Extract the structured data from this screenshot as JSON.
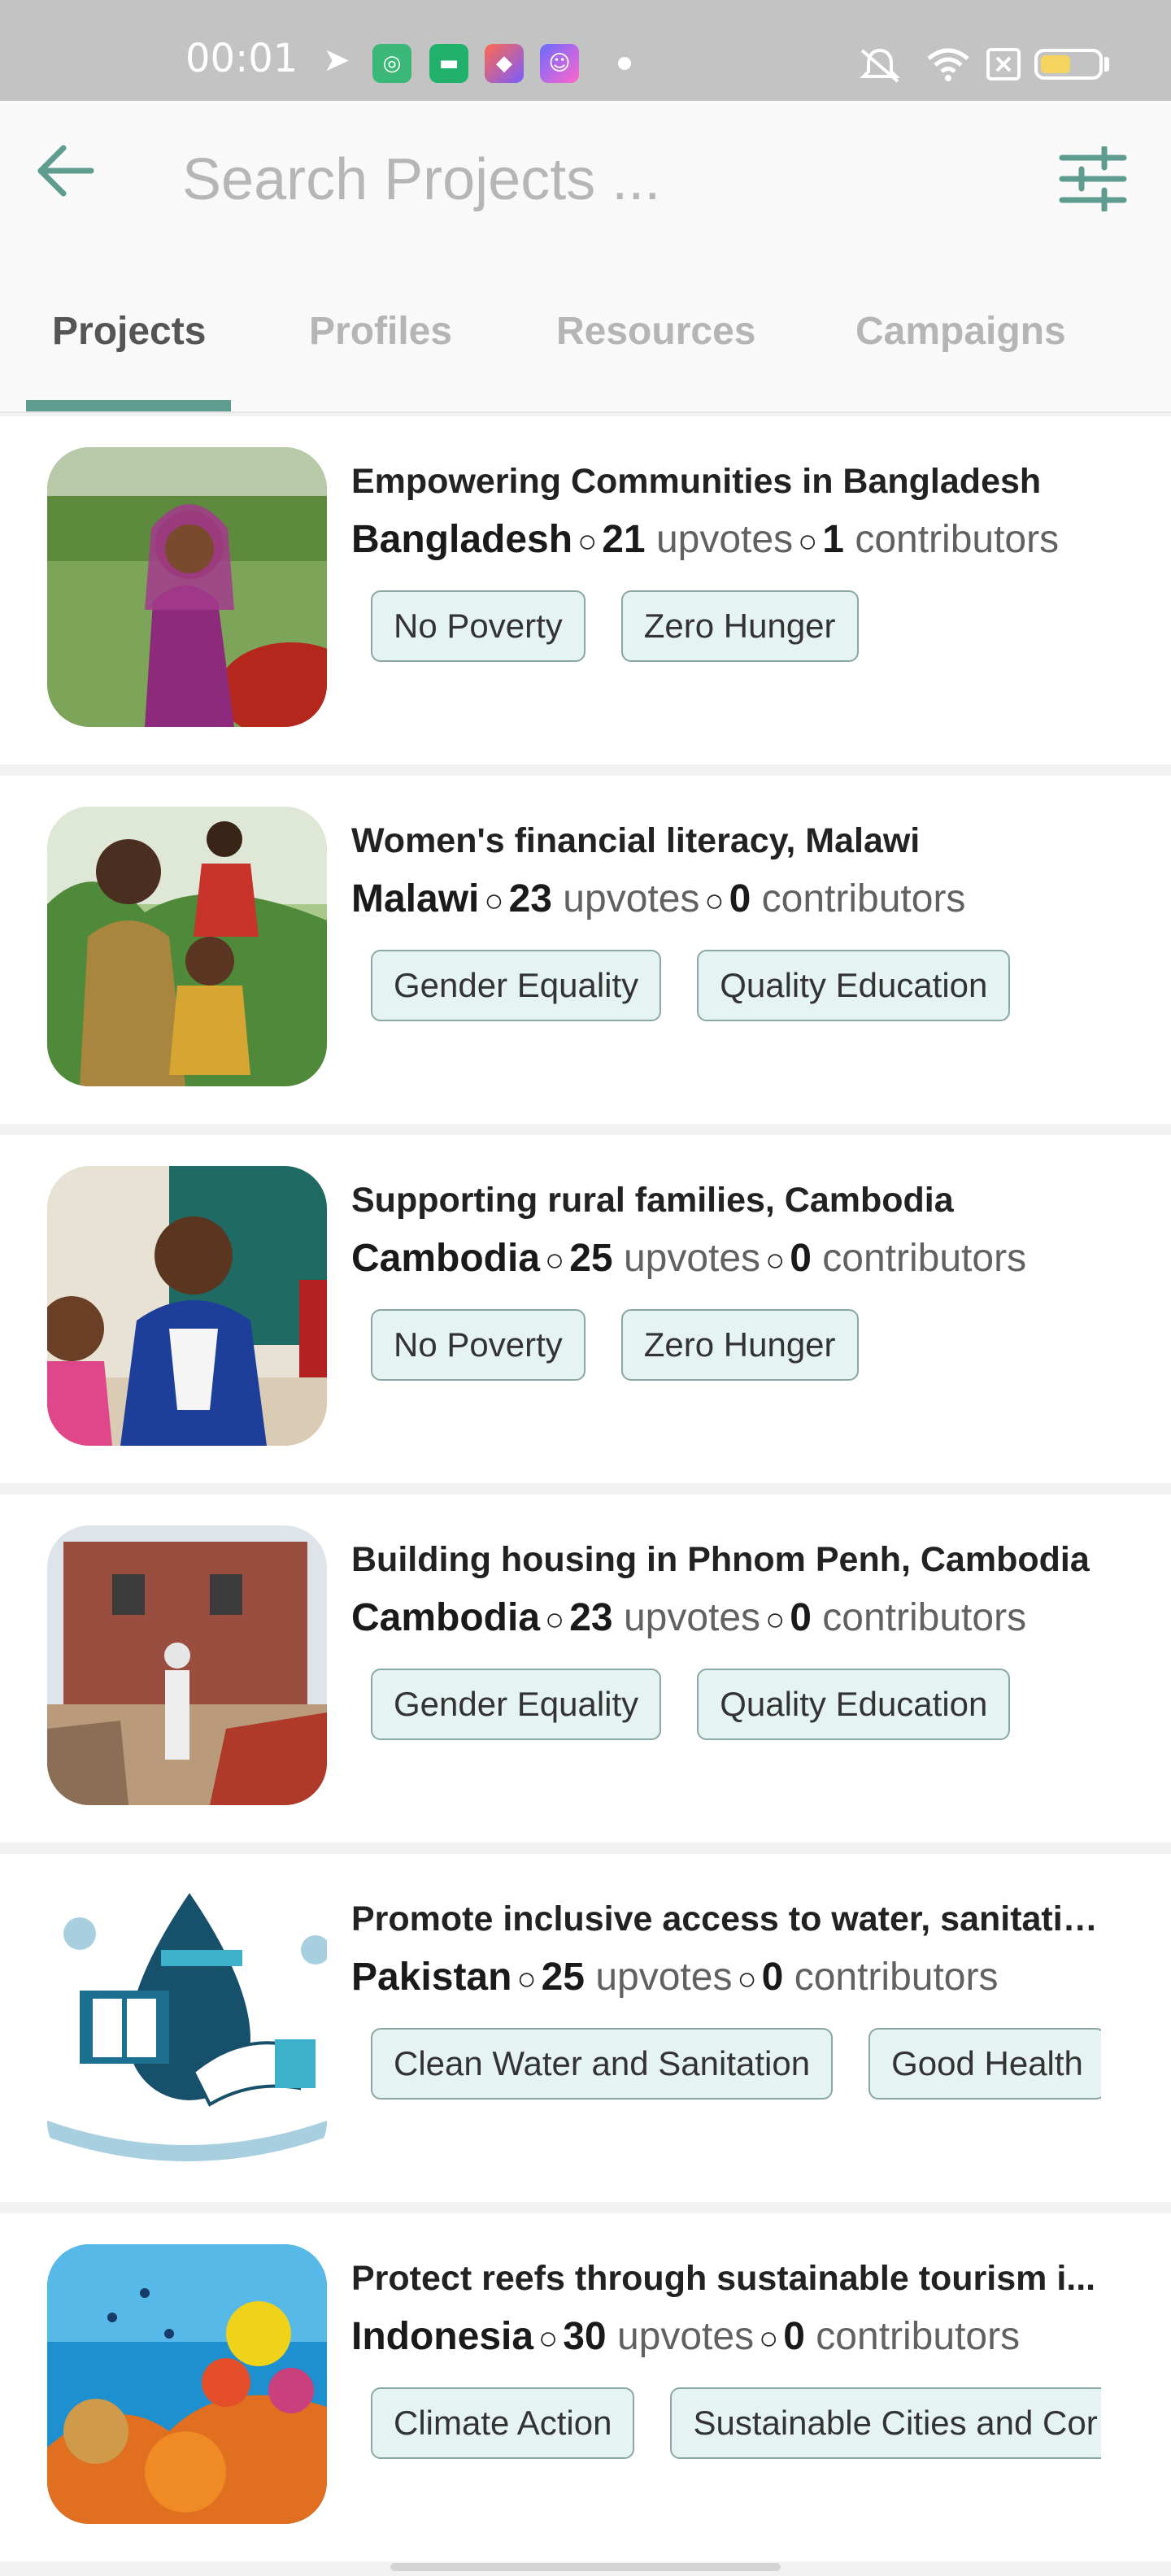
{
  "status_bar": {
    "time": "00:01"
  },
  "search": {
    "placeholder": "Search Projects ..."
  },
  "tabs": [
    {
      "label": "Projects",
      "active": true
    },
    {
      "label": "Profiles",
      "active": false
    },
    {
      "label": "Resources",
      "active": false
    },
    {
      "label": "Campaigns",
      "active": false
    }
  ],
  "projects": [
    {
      "title": "Empowering Communities in Bangladesh",
      "country": "Bangladesh",
      "upvotes": "21",
      "upvotes_label": "upvotes",
      "contributors": "1",
      "contributors_label": "contributors",
      "tags": [
        "No Poverty",
        "Zero Hunger"
      ]
    },
    {
      "title": "Women's financial literacy, Malawi",
      "country": "Malawi",
      "upvotes": "23",
      "upvotes_label": "upvotes",
      "contributors": "0",
      "contributors_label": "contributors",
      "tags": [
        "Gender Equality",
        "Quality Education"
      ]
    },
    {
      "title": "Supporting rural families, Cambodia",
      "country": "Cambodia",
      "upvotes": "25",
      "upvotes_label": "upvotes",
      "contributors": "0",
      "contributors_label": "contributors",
      "tags": [
        "No Poverty",
        "Zero Hunger"
      ]
    },
    {
      "title": "Building housing in Phnom Penh, Cambodia",
      "country": "Cambodia",
      "upvotes": "23",
      "upvotes_label": "upvotes",
      "contributors": "0",
      "contributors_label": "contributors",
      "tags": [
        "Gender Equality",
        "Quality Education"
      ]
    },
    {
      "title": "Promote inclusive access to water, sanitatio...",
      "country": "Pakistan",
      "upvotes": "25",
      "upvotes_label": "upvotes",
      "contributors": "0",
      "contributors_label": "contributors",
      "tags": [
        "Clean Water and Sanitation",
        "Good Health"
      ]
    },
    {
      "title": "Protect reefs through sustainable tourism i...",
      "country": "Indonesia",
      "upvotes": "30",
      "upvotes_label": "upvotes",
      "contributors": "0",
      "contributors_label": "contributors",
      "tags": [
        "Climate Action",
        "Sustainable Cities and Cor"
      ]
    }
  ],
  "colors": {
    "accent": "#5e9c90",
    "tag_bg": "#e5f3f2",
    "status_bar": "#c3c3c3"
  }
}
